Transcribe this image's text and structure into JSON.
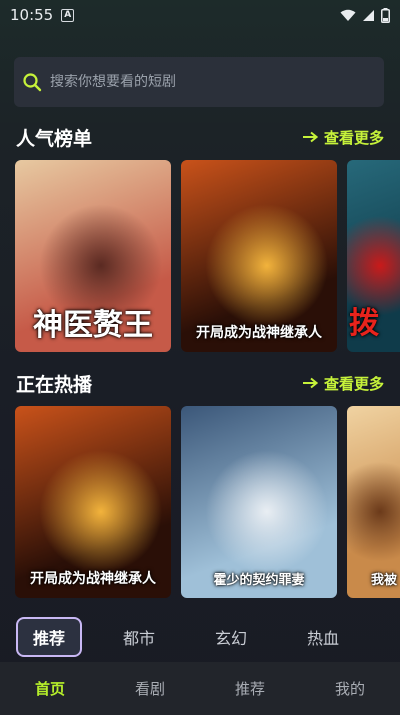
{
  "status_bar": {
    "time": "10:55",
    "notification_letter": "A"
  },
  "search": {
    "placeholder": "搜索你想要看的短剧"
  },
  "sections": {
    "popular": {
      "title": "人气榜单",
      "more_label": "查看更多",
      "cards": [
        {
          "caption": "神医赘王",
          "colors": [
            "#c65a48",
            "#e7c9a1",
            "#5a2a22"
          ]
        },
        {
          "caption": "开局成为战神继承人",
          "colors": [
            "#2a0f07",
            "#c9521a",
            "#f2b33c"
          ]
        },
        {
          "caption": "拨",
          "colors": [
            "#0f3b4a",
            "#27697a",
            "#c91a1a"
          ]
        }
      ]
    },
    "trending": {
      "title": "正在热播",
      "more_label": "查看更多",
      "cards": [
        {
          "caption": "开局成为战神继承人",
          "colors": [
            "#2a0f07",
            "#c9521a",
            "#f2b33c"
          ]
        },
        {
          "caption": "霍少的契约罪妻",
          "colors": [
            "#9fc0d8",
            "#3b5779",
            "#e9eef3"
          ]
        },
        {
          "caption": "我被",
          "colors": [
            "#c98a4a",
            "#f0d3a2",
            "#6b3a1a"
          ]
        }
      ]
    }
  },
  "categories": [
    {
      "label": "推荐",
      "active": true
    },
    {
      "label": "都市",
      "active": false
    },
    {
      "label": "玄幻",
      "active": false
    },
    {
      "label": "热血",
      "active": false
    }
  ],
  "bottom_nav": [
    {
      "label": "首页",
      "active": true
    },
    {
      "label": "看剧",
      "active": false
    },
    {
      "label": "推荐",
      "active": false
    },
    {
      "label": "我的",
      "active": false
    }
  ],
  "accent_color": "#c6f23a",
  "icons": [
    "search-icon",
    "arrow-right-icon",
    "wifi-icon",
    "signal-icon",
    "battery-icon"
  ]
}
